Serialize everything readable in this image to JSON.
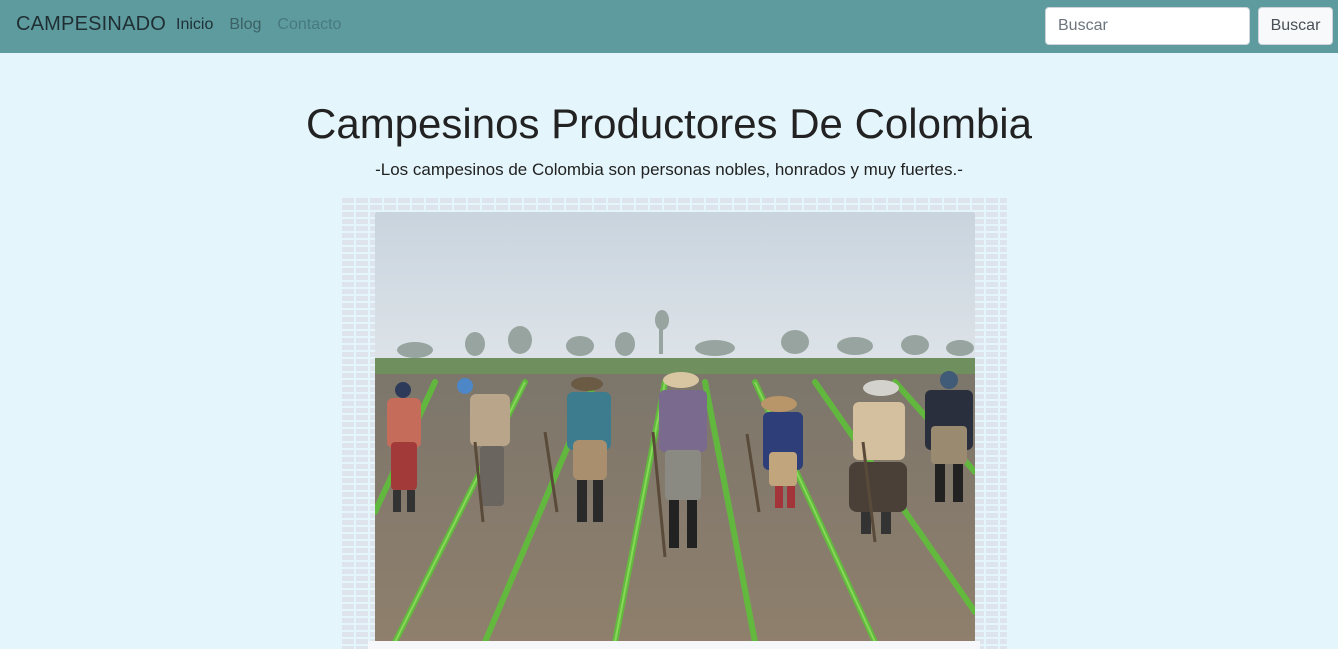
{
  "navbar": {
    "brand": "CAMPESINADO",
    "links": [
      {
        "label": "Inicio",
        "state": "active"
      },
      {
        "label": "Blog",
        "state": "normal"
      },
      {
        "label": "Contacto",
        "state": "disabled"
      }
    ],
    "search": {
      "placeholder": "Buscar",
      "value": ""
    },
    "search_button_label": "Buscar"
  },
  "hero": {
    "title": "Campesinos Productores De Colombia",
    "subtitle": "-Los campesinos de Colombia son personas nobles, honrados y muy fuertes.-"
  },
  "figure": {
    "image": "farmers-planting-field-photo",
    "caption": ""
  },
  "colors": {
    "navbar_bg": "#5e9b9f",
    "page_bg": "#e4f6fc"
  }
}
